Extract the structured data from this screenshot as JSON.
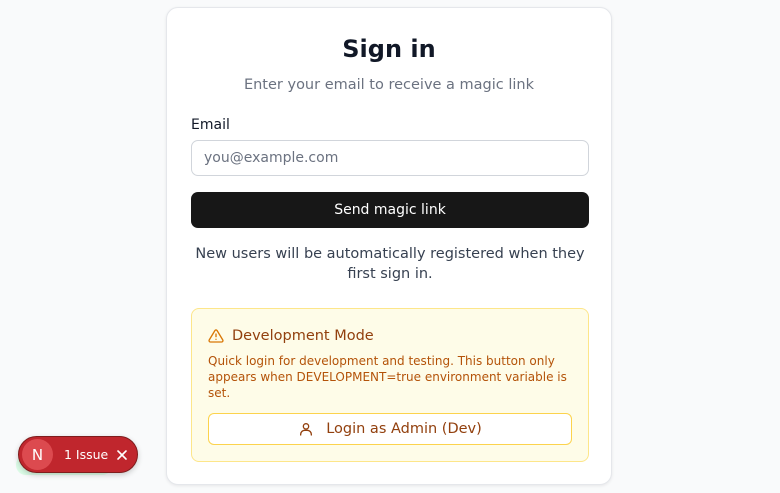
{
  "signin": {
    "title": "Sign in",
    "subtitle": "Enter your email to receive a magic link",
    "email_label": "Email",
    "email_placeholder": "you@example.com",
    "email_value": "",
    "send_button": "Send magic link",
    "info_text": "New users will be automatically registered when they first sign in."
  },
  "dev_mode": {
    "title": "Development Mode",
    "description": "Quick login for development and testing. This button only appears when DEVELOPMENT=true environment variable is set.",
    "login_button": "Login as Admin (Dev)",
    "icons": {
      "warning": "warning-triangle-icon",
      "user": "user-icon"
    }
  },
  "issue_indicator": {
    "badge_letter": "N",
    "label": "1 Issue",
    "close_icon": "close-icon"
  },
  "colors": {
    "primary_button": "#171717",
    "dev_background": "#fefce8",
    "dev_border": "#fde68a",
    "dev_text": "#92400e",
    "issue_red": "#c0262d"
  }
}
